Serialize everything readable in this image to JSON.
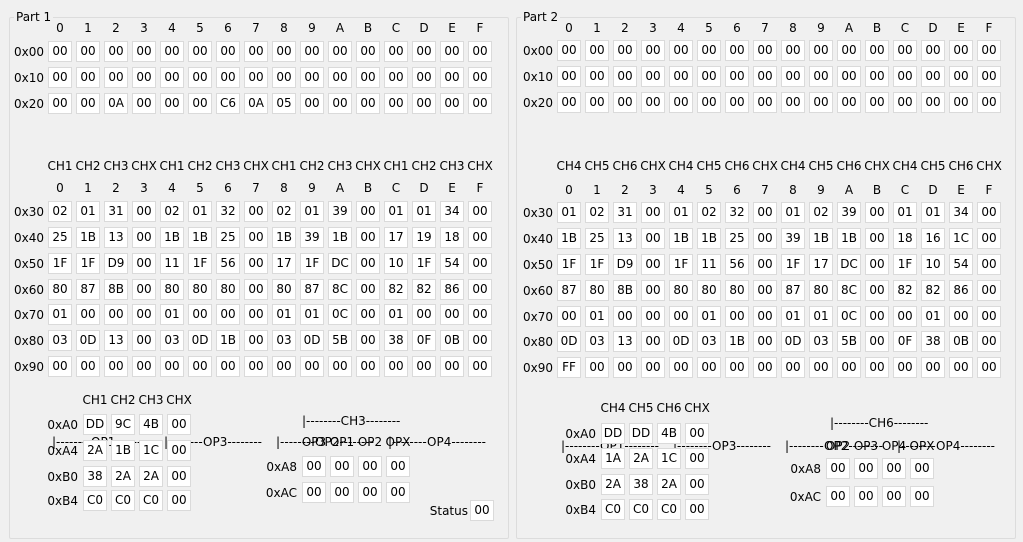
{
  "part1": {
    "title": "Part 1",
    "col_headers": [
      "0",
      "1",
      "2",
      "3",
      "4",
      "5",
      "6",
      "7",
      "8",
      "9",
      "A",
      "B",
      "C",
      "D",
      "E",
      "F"
    ],
    "top_rows": [
      {
        "label": "0x00",
        "cells": [
          "00",
          "00",
          "00",
          "00",
          "00",
          "00",
          "00",
          "00",
          "00",
          "00",
          "00",
          "00",
          "00",
          "00",
          "00",
          "00"
        ]
      },
      {
        "label": "0x10",
        "cells": [
          "00",
          "00",
          "00",
          "00",
          "00",
          "00",
          "00",
          "00",
          "00",
          "00",
          "00",
          "00",
          "00",
          "00",
          "00",
          "00"
        ]
      },
      {
        "label": "0x20",
        "cells": [
          "00",
          "00",
          "0A",
          "00",
          "00",
          "00",
          "C6",
          "0A",
          "05",
          "00",
          "00",
          "00",
          "00",
          "00",
          "00",
          "00"
        ]
      }
    ],
    "op_groups": [
      "|--------OP1--------",
      "|--------OP3--------",
      "|--------OP2--------",
      "|--------OP4--------"
    ],
    "ch_labels": [
      "CH1",
      "CH2",
      "CH3",
      "CHX",
      "CH1",
      "CH2",
      "CH3",
      "CHX",
      "CH1",
      "CH2",
      "CH3",
      "CHX",
      "CH1",
      "CH2",
      "CH3",
      "CHX"
    ],
    "mid_rows": [
      {
        "label": "0x30",
        "cells": [
          "02",
          "01",
          "31",
          "00",
          "02",
          "01",
          "32",
          "00",
          "02",
          "01",
          "39",
          "00",
          "01",
          "01",
          "34",
          "00"
        ]
      },
      {
        "label": "0x40",
        "cells": [
          "25",
          "1B",
          "13",
          "00",
          "1B",
          "1B",
          "25",
          "00",
          "1B",
          "39",
          "1B",
          "00",
          "17",
          "19",
          "18",
          "00"
        ]
      },
      {
        "label": "0x50",
        "cells": [
          "1F",
          "1F",
          "D9",
          "00",
          "11",
          "1F",
          "56",
          "00",
          "17",
          "1F",
          "DC",
          "00",
          "10",
          "1F",
          "54",
          "00"
        ]
      },
      {
        "label": "0x60",
        "cells": [
          "80",
          "87",
          "8B",
          "00",
          "80",
          "80",
          "80",
          "00",
          "80",
          "87",
          "8C",
          "00",
          "82",
          "82",
          "86",
          "00"
        ]
      },
      {
        "label": "0x70",
        "cells": [
          "01",
          "00",
          "00",
          "00",
          "01",
          "00",
          "00",
          "00",
          "01",
          "01",
          "0C",
          "00",
          "01",
          "00",
          "00",
          "00"
        ]
      },
      {
        "label": "0x80",
        "cells": [
          "03",
          "0D",
          "13",
          "00",
          "03",
          "0D",
          "1B",
          "00",
          "03",
          "0D",
          "5B",
          "00",
          "38",
          "0F",
          "0B",
          "00"
        ]
      },
      {
        "label": "0x90",
        "cells": [
          "00",
          "00",
          "00",
          "00",
          "00",
          "00",
          "00",
          "00",
          "00",
          "00",
          "00",
          "00",
          "00",
          "00",
          "00",
          "00"
        ]
      }
    ],
    "a_headers": [
      "CH1",
      "CH2",
      "CH3",
      "CHX"
    ],
    "a_rows": [
      {
        "label": "0xA0",
        "cells": [
          "DD",
          "9C",
          "4B",
          "00"
        ]
      },
      {
        "label": "0xA4",
        "cells": [
          "2A",
          "1B",
          "1C",
          "00"
        ]
      },
      {
        "label": "0xB0",
        "cells": [
          "38",
          "2A",
          "2A",
          "00"
        ]
      },
      {
        "label": "0xB4",
        "cells": [
          "C0",
          "C0",
          "C0",
          "00"
        ]
      }
    ],
    "op_title": "|--------CH3--------",
    "op_headers": [
      "OP3",
      "OP1",
      "OP2",
      "OPX"
    ],
    "op_rows": [
      {
        "label": "0xA8",
        "cells": [
          "00",
          "00",
          "00",
          "00"
        ]
      },
      {
        "label": "0xAC",
        "cells": [
          "00",
          "00",
          "00",
          "00"
        ]
      }
    ],
    "status_label": "Status",
    "status_value": "00"
  },
  "part2": {
    "title": "Part 2",
    "col_headers": [
      "0",
      "1",
      "2",
      "3",
      "4",
      "5",
      "6",
      "7",
      "8",
      "9",
      "A",
      "B",
      "C",
      "D",
      "E",
      "F"
    ],
    "top_rows": [
      {
        "label": "0x00",
        "cells": [
          "00",
          "00",
          "00",
          "00",
          "00",
          "00",
          "00",
          "00",
          "00",
          "00",
          "00",
          "00",
          "00",
          "00",
          "00",
          "00"
        ]
      },
      {
        "label": "0x10",
        "cells": [
          "00",
          "00",
          "00",
          "00",
          "00",
          "00",
          "00",
          "00",
          "00",
          "00",
          "00",
          "00",
          "00",
          "00",
          "00",
          "00"
        ]
      },
      {
        "label": "0x20",
        "cells": [
          "00",
          "00",
          "00",
          "00",
          "00",
          "00",
          "00",
          "00",
          "00",
          "00",
          "00",
          "00",
          "00",
          "00",
          "00",
          "00"
        ]
      }
    ],
    "op_groups": [
      "|--------OP1--------",
      "|--------OP3--------",
      "|--------OP2--------",
      "|--------OP4--------"
    ],
    "ch_labels": [
      "CH4",
      "CH5",
      "CH6",
      "CHX",
      "CH4",
      "CH5",
      "CH6",
      "CHX",
      "CH4",
      "CH5",
      "CH6",
      "CHX",
      "CH4",
      "CH5",
      "CH6",
      "CHX"
    ],
    "mid_rows": [
      {
        "label": "0x30",
        "cells": [
          "01",
          "02",
          "31",
          "00",
          "01",
          "02",
          "32",
          "00",
          "01",
          "02",
          "39",
          "00",
          "01",
          "01",
          "34",
          "00"
        ]
      },
      {
        "label": "0x40",
        "cells": [
          "1B",
          "25",
          "13",
          "00",
          "1B",
          "1B",
          "25",
          "00",
          "39",
          "1B",
          "1B",
          "00",
          "18",
          "16",
          "1C",
          "00"
        ]
      },
      {
        "label": "0x50",
        "cells": [
          "1F",
          "1F",
          "D9",
          "00",
          "1F",
          "11",
          "56",
          "00",
          "1F",
          "17",
          "DC",
          "00",
          "1F",
          "10",
          "54",
          "00"
        ]
      },
      {
        "label": "0x60",
        "cells": [
          "87",
          "80",
          "8B",
          "00",
          "80",
          "80",
          "80",
          "00",
          "87",
          "80",
          "8C",
          "00",
          "82",
          "82",
          "86",
          "00"
        ]
      },
      {
        "label": "0x70",
        "cells": [
          "00",
          "01",
          "00",
          "00",
          "00",
          "01",
          "00",
          "00",
          "01",
          "01",
          "0C",
          "00",
          "00",
          "01",
          "00",
          "00"
        ]
      },
      {
        "label": "0x80",
        "cells": [
          "0D",
          "03",
          "13",
          "00",
          "0D",
          "03",
          "1B",
          "00",
          "0D",
          "03",
          "5B",
          "00",
          "0F",
          "38",
          "0B",
          "00"
        ]
      },
      {
        "label": "0x90",
        "cells": [
          "FF",
          "00",
          "00",
          "00",
          "00",
          "00",
          "00",
          "00",
          "00",
          "00",
          "00",
          "00",
          "00",
          "00",
          "00",
          "00"
        ]
      }
    ],
    "a_headers": [
      "CH4",
      "CH5",
      "CH6",
      "CHX"
    ],
    "a_rows": [
      {
        "label": "0xA0",
        "cells": [
          "DD",
          "DD",
          "4B",
          "00"
        ]
      },
      {
        "label": "0xA4",
        "cells": [
          "1A",
          "2A",
          "1C",
          "00"
        ]
      },
      {
        "label": "0xB0",
        "cells": [
          "2A",
          "38",
          "2A",
          "00"
        ]
      },
      {
        "label": "0xB4",
        "cells": [
          "C0",
          "C0",
          "C0",
          "00"
        ]
      }
    ],
    "op_title": "|--------CH6--------",
    "op_headers": [
      "OP2",
      "OP3",
      "OP4",
      "OPX"
    ],
    "op_rows": [
      {
        "label": "0xA8",
        "cells": [
          "00",
          "00",
          "00",
          "00"
        ]
      },
      {
        "label": "0xAC",
        "cells": [
          "00",
          "00",
          "00",
          "00"
        ]
      }
    ]
  }
}
